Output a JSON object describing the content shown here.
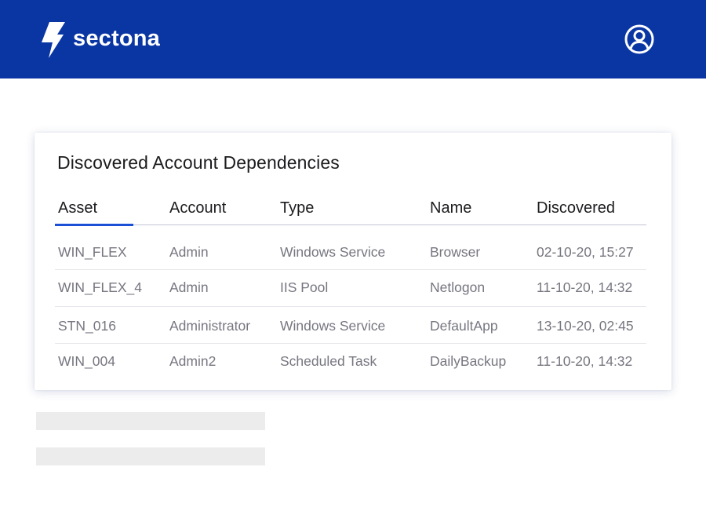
{
  "header": {
    "brand": "sectona",
    "logo_icon": "lightning-bolt-icon",
    "user_icon": "user-circle-icon",
    "bg_color": "#0a36a3"
  },
  "card": {
    "title": "Discovered Account Dependencies",
    "active_column": "Asset",
    "accent_color": "#1a4fd6",
    "columns": [
      "Asset",
      "Account",
      "Type",
      "Name",
      "Discovered"
    ],
    "rows": [
      [
        "WIN_FLEX",
        "Admin",
        "Windows Service",
        "Browser",
        "02-10-20, 15:27"
      ],
      [
        "WIN_FLEX_4",
        "Admin",
        "IIS Pool",
        "Netlogon",
        "11-10-20, 14:32"
      ],
      [
        "STN_016",
        "Administrator",
        "Windows Service",
        "DefaultApp",
        "13-10-20, 02:45"
      ],
      [
        "WIN_004",
        "Admin2",
        "Scheduled Task",
        "DailyBackup",
        "11-10-20, 14:32"
      ]
    ]
  }
}
